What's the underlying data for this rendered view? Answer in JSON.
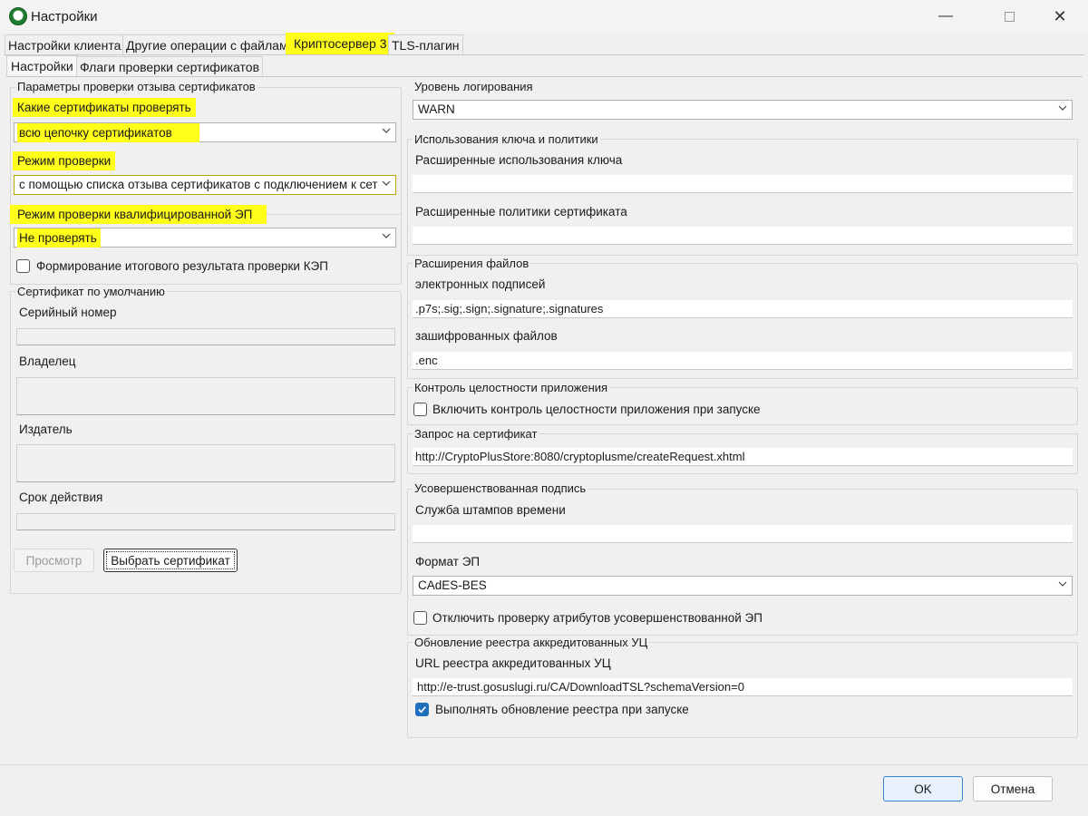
{
  "window": {
    "title": "Настройки"
  },
  "tabs": [
    "Настройки клиента",
    "Другие операции с файлами",
    "Криптосервер 3",
    "TLS-плагин"
  ],
  "subtabs": [
    "Настройки",
    "Флаги проверки сертификатов"
  ],
  "revocation": {
    "group_title": "Параметры проверки отзыва сертификатов",
    "which_label": "Какие сертификаты проверять",
    "which_value": "всю цепочку сертификатов",
    "mode_label": "Режим проверки",
    "mode_value": "с помощью списка отзыва сертификатов с подключением к сет",
    "qual_label": "Режим проверки квалифицированной ЭП",
    "qual_value": "Не проверять",
    "final_result_label": "Формирование итогового результата проверки КЭП"
  },
  "default_cert": {
    "group_title": "Сертификат по умолчанию",
    "serial_label": "Серийный номер",
    "owner_label": "Владелец",
    "issuer_label": "Издатель",
    "validity_label": "Срок действия",
    "view_button": "Просмотр",
    "select_button": "Выбрать сертификат"
  },
  "logging": {
    "group_title": "Уровень логирования",
    "value": "WARN"
  },
  "key_usage": {
    "group_title": "Использования ключа и политики",
    "eku_label": "Расширенные использования ключа",
    "policies_label": "Расширенные политики сертификата"
  },
  "file_ext": {
    "group_title": "Расширения файлов",
    "sig_label": "электронных подписей",
    "sig_value": ".p7s;.sig;.sign;.signature;.signatures",
    "enc_label": "зашифрованных файлов",
    "enc_value": ".enc"
  },
  "integrity": {
    "group_title": "Контроль целостности приложения",
    "checkbox_label": "Включить контроль целостности приложения при запуске"
  },
  "cert_request": {
    "group_title": "Запрос на сертификат",
    "url": "http://CryptoPlusStore:8080/cryptoplusme/createRequest.xhtml"
  },
  "advanced_sig": {
    "group_title": "Усовершенствованная подпись",
    "tsp_label": "Служба штампов времени",
    "format_label": "Формат ЭП",
    "format_value": "CAdES-BES",
    "disable_attr_label": "Отключить проверку атрибутов усовершенствованной ЭП"
  },
  "registry": {
    "group_title": "Обновление реестра аккредитованных УЦ",
    "url_label": "URL реестра аккредитованных УЦ",
    "url_value": "http://e-trust.gosuslugi.ru/CA/DownloadTSL?schemaVersion=0",
    "update_label": "Выполнять обновление реестра при запуске"
  },
  "footer": {
    "ok": "OK",
    "cancel": "Отмена"
  },
  "colors": {
    "highlight": "#ffff1a",
    "checkbox_checked": "#1f6fbf",
    "ok_border": "#3b87d6"
  }
}
